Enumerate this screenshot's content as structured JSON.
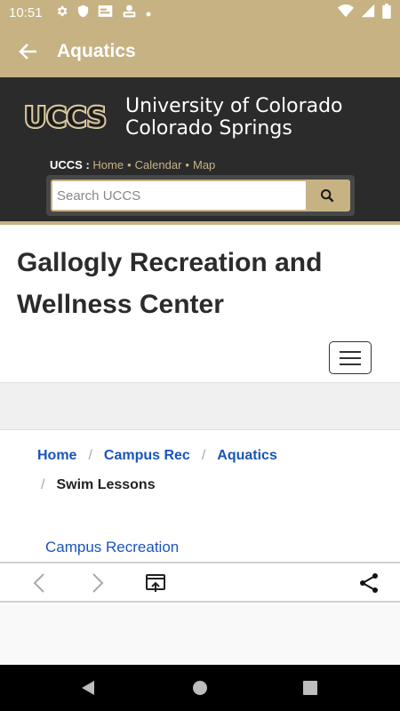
{
  "status_bar": {
    "time": "10:51",
    "left_icons": [
      "gear-icon",
      "shield-icon",
      "sim-icon",
      "accessibility-icon",
      "dot-icon"
    ],
    "right_icons": [
      "wifi-icon",
      "signal-icon",
      "battery-icon"
    ]
  },
  "app_bar": {
    "title": "Aquatics",
    "back_icon": "arrow-left-icon",
    "color": "#c6b283"
  },
  "uccs": {
    "logo_text": "UCCS",
    "university_line1": "University of Colorado",
    "university_line2": "Colorado Springs",
    "nav_label": "UCCS :",
    "nav_links": [
      "Home",
      "Calendar",
      "Map"
    ],
    "nav_separator": "•",
    "search_placeholder": "Search UCCS",
    "search_icon": "search-icon",
    "gold": "#c6b283",
    "dark": "#2b2b2b"
  },
  "site": {
    "title": "Gallogly Recreation and Wellness Center",
    "menu_icon": "hamburger-menu-icon"
  },
  "breadcrumb": {
    "items": [
      "Home",
      "Campus Rec",
      "Aquatics"
    ],
    "current": "Swim Lessons",
    "separator": "/"
  },
  "content": {
    "link": "Campus Recreation"
  },
  "browser_toolbar": {
    "back_icon": "chevron-left-icon",
    "forward_icon": "chevron-right-icon",
    "open_in_browser_icon": "open-in-browser-icon",
    "share_icon": "share-icon"
  },
  "nav_bar": {
    "back_icon": "triangle-back-icon",
    "home_icon": "circle-home-icon",
    "recents_icon": "square-recents-icon"
  }
}
